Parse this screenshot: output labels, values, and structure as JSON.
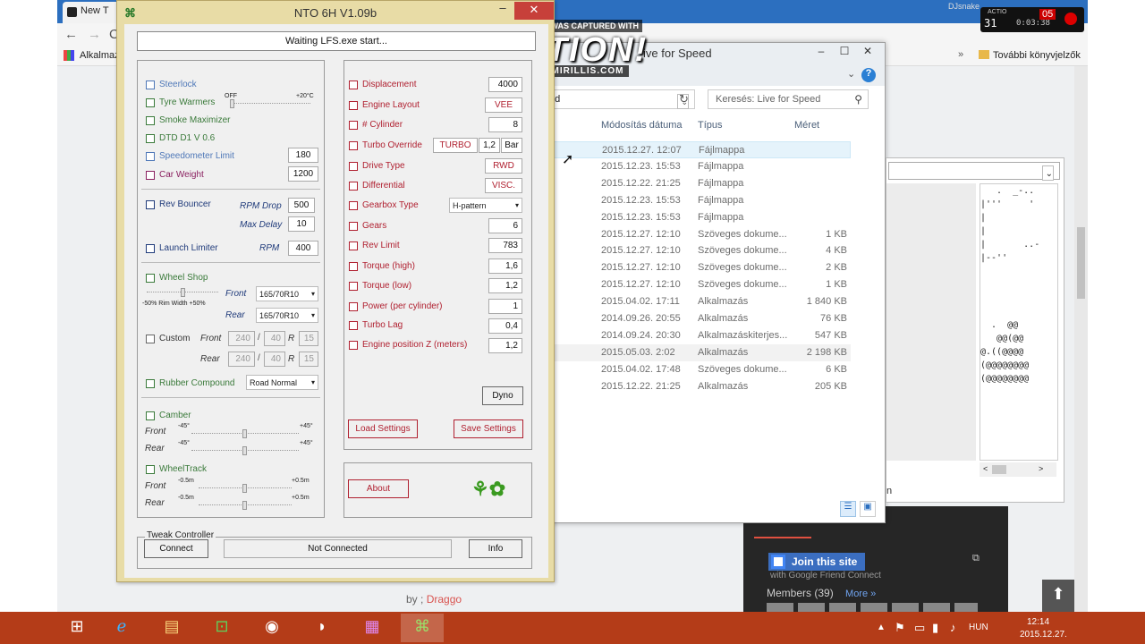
{
  "browser": {
    "tab_title": "New T",
    "bookmark_apps": "Alkalmaz",
    "bookmark_more": "»",
    "bookmark_folder": "További könyvjelzők",
    "author_prefix": "by ;",
    "author_name": "Draggo",
    "widget_title": "Join this site",
    "widget_sub": "with Google Friend Connect",
    "members_label": "Members (39)",
    "members_more": "More »",
    "scrolltop_icon": "arrow-up"
  },
  "overlay": {
    "captured_text": "THIS VIDEO WAS CAPTURED WITH",
    "brand": "ACTION!",
    "url": "WWW.MIRILLIS.COM",
    "rec_fps_label": "ACTIO",
    "rec_fps": "31",
    "rec_time": "0:03:38",
    "rec_count": "05",
    "user": "DJsnake"
  },
  "explorer": {
    "title": "ive for Speed",
    "address": "ed",
    "search_placeholder": "Keresés: Live for Speed",
    "columns": {
      "date": "Módosítás dátuma",
      "type": "Típus",
      "size": "Méret"
    },
    "rows": [
      {
        "date": "2015.12.27. 12:07",
        "type": "Fájlmappa",
        "size": "",
        "selected": true
      },
      {
        "date": "2015.12.23. 15:53",
        "type": "Fájlmappa",
        "size": ""
      },
      {
        "date": "2015.12.22. 21:25",
        "type": "Fájlmappa",
        "size": ""
      },
      {
        "date": "2015.12.23. 15:53",
        "type": "Fájlmappa",
        "size": ""
      },
      {
        "date": "2015.12.23. 15:53",
        "type": "Fájlmappa",
        "size": ""
      },
      {
        "date": "2015.12.27. 12:10",
        "type": "Szöveges dokume...",
        "size": "1 KB"
      },
      {
        "date": "2015.12.27. 12:10",
        "type": "Szöveges dokume...",
        "size": "4 KB"
      },
      {
        "date": "2015.12.27. 12:10",
        "type": "Szöveges dokume...",
        "size": "2 KB"
      },
      {
        "date": "2015.12.27. 12:10",
        "type": "Szöveges dokume...",
        "size": "1 KB"
      },
      {
        "date": "2015.04.02. 17:11",
        "type": "Alkalmazás",
        "size": "1 840 KB"
      },
      {
        "date": "2014.09.26. 20:55",
        "type": "Alkalmazás",
        "size": "76 KB"
      },
      {
        "date": "2014.09.24. 20:30",
        "type": "Alkalmazáskiterjes...",
        "size": "547 KB"
      },
      {
        "date": "2015.05.03. 2:02",
        "type": "Alkalmazás",
        "size": "2 198 KB",
        "hover": true
      },
      {
        "date": "2015.04.02. 17:48",
        "type": "Szöveges dokume...",
        "size": "6 KB"
      },
      {
        "date": "2015.12.22. 21:25",
        "type": "Alkalmazás",
        "size": "205 KB"
      }
    ]
  },
  "right_window": {
    "ascii": "   .  _-..\n|'''     '\n|\n|\n|       ..-\n|--''     \n\n\n\n\n  .  @@\n   @@(@@\n@.((@@@@\n(@@@@@@@@\n(@@@@@@@@",
    "label": "n"
  },
  "nto": {
    "title": "NTO 6H V1.09b",
    "status": "Waiting LFS.exe start...",
    "left": {
      "steerlock": "Steerlock",
      "tyre_warmers": "Tyre Warmers",
      "tw_off": "OFF",
      "tw_max": "+20°C",
      "smoke": "Smoke Maximizer",
      "dtd": "DTD D1 V 0.6",
      "speedo": "Speedometer Limit",
      "speedo_val": "180",
      "car_weight": "Car Weight",
      "car_weight_val": "1200",
      "rev_bouncer": "Rev Bouncer",
      "rpm_drop": "RPM Drop",
      "rpm_drop_val": "500",
      "max_delay": "Max Delay",
      "max_delay_val": "10",
      "launch_limiter": "Launch Limiter",
      "rpm": "RPM",
      "rpm_val": "400",
      "wheel_shop": "Wheel Shop",
      "rim_width": "-50% Rim Width +50%",
      "front": "Front",
      "rear": "Rear",
      "front_tyre": "165/70R10",
      "rear_tyre": "165/70R10",
      "custom": "Custom",
      "custom_front": [
        "240",
        "40",
        "15"
      ],
      "custom_rear": [
        "240",
        "40",
        "15"
      ],
      "slash": "/",
      "r": "R",
      "rubber": "Rubber Compound",
      "rubber_val": "Road Normal",
      "camber": "Camber",
      "camber_min": "-45°",
      "camber_max": "+45°",
      "wheeltrack": "WheelTrack",
      "wt_min": "-0.5m",
      "wt_max": "+0.5m"
    },
    "right": {
      "displacement": "Displacement",
      "displacement_val": "4000",
      "layout": "Engine Layout",
      "layout_val": "VEE",
      "cylinder": "# Cylinder",
      "cylinder_val": "8",
      "turbo": "Turbo Override",
      "turbo_val": "TURBO",
      "turbo_bar": "1,2",
      "bar": "Bar",
      "drive": "Drive Type",
      "drive_val": "RWD",
      "diff": "Differential",
      "diff_val": "VISC.",
      "gearbox": "Gearbox Type",
      "gearbox_val": "H-pattern",
      "gears": "Gears",
      "gears_val": "6",
      "rev_limit": "Rev Limit",
      "rev_limit_val": "783",
      "torque_high": "Torque (high)",
      "torque_high_val": "1,6",
      "torque_low": "Torque (low)",
      "torque_low_val": "1,2",
      "power": "Power (per cylinder)",
      "power_val": "1",
      "turbo_lag": "Turbo Lag",
      "turbo_lag_val": "0,4",
      "engine_z": "Engine position Z (meters)",
      "engine_z_val": "1,2",
      "dyno": "Dyno",
      "load": "Load Settings",
      "save": "Save Settings"
    },
    "about": "About",
    "tweak": {
      "legend": "Tweak Controller",
      "connect": "Connect",
      "status": "Not Connected",
      "info": "Info"
    }
  },
  "taskbar": {
    "lang": "HUN",
    "time": "12:14",
    "date": "2015.12.27."
  }
}
